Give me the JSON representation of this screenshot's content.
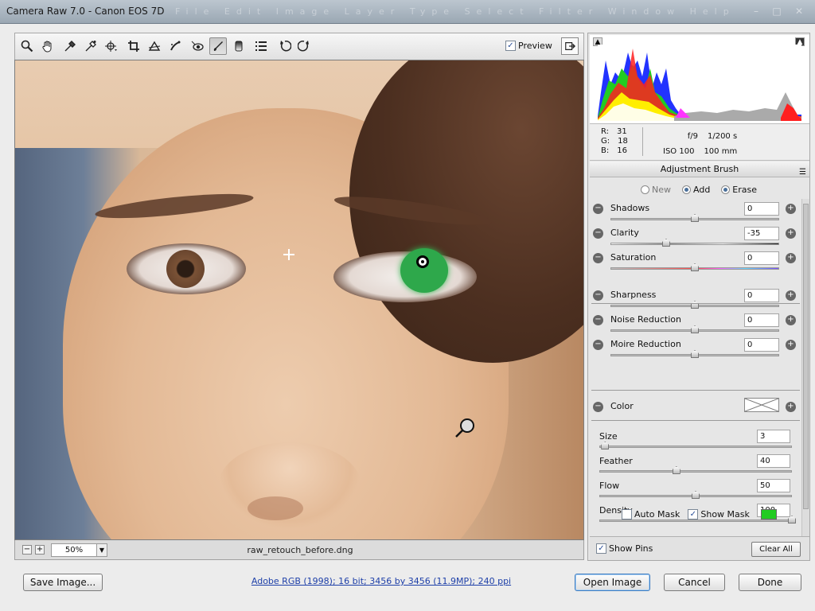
{
  "window": {
    "title": "Camera Raw 7.0  -  Canon EOS 7D",
    "faint_menu": "File  Edit  Image  Layer  Type  Select  Filter  Window  Help"
  },
  "toolbar": {
    "tools": [
      "zoom-icon",
      "hand-icon",
      "white-balance-icon",
      "color-sampler-icon",
      "targeted-adjust-icon",
      "crop-icon",
      "straighten-icon",
      "spot-removal-icon",
      "red-eye-icon",
      "adjustment-brush-icon",
      "graduated-filter-icon",
      "preferences-icon",
      "rotate-ccw-icon",
      "rotate-cw-icon"
    ],
    "active_tool": "adjustment-brush-icon",
    "preview_label": "Preview",
    "preview_checked": true
  },
  "canvas": {
    "zoom_minus": "−",
    "zoom_plus": "+",
    "zoom_value": "50%",
    "filename": "raw_retouch_before.dng"
  },
  "histogram": {
    "colors": {
      "red": "#ff2020",
      "green": "#22cc22",
      "blue": "#2233ff",
      "yellow": "#ffee00",
      "magenta": "#ff33ff",
      "cyan": "#22ddee"
    }
  },
  "readout": {
    "r_label": "R:",
    "r_value": "31",
    "g_label": "G:",
    "g_value": "18",
    "b_label": "B:",
    "b_value": "16",
    "aperture": "f/9",
    "shutter": "1/200 s",
    "iso": "ISO 100",
    "focal": "100 mm"
  },
  "panel": {
    "title": "Adjustment Brush",
    "modes": [
      {
        "label": "New",
        "selected": false
      },
      {
        "label": "Add",
        "selected": true
      },
      {
        "label": "Erase",
        "selected": true
      }
    ],
    "sliders": [
      {
        "label": "Shadows",
        "value": "0",
        "pos": 0.5,
        "track": "plain"
      },
      {
        "label": "Clarity",
        "value": "-35",
        "pos": 0.33,
        "track": "clarity"
      },
      {
        "label": "Saturation",
        "value": "0",
        "pos": 0.5,
        "track": "sat"
      },
      {
        "label": "Sharpness",
        "value": "0",
        "pos": 0.5,
        "track": "plain"
      },
      {
        "label": "Noise Reduction",
        "value": "0",
        "pos": 0.5,
        "track": "plain"
      },
      {
        "label": "Moire Reduction",
        "value": "0",
        "pos": 0.5,
        "track": "plain"
      }
    ],
    "color_label": "Color",
    "brush": [
      {
        "label": "Size",
        "value": "3",
        "pos": 0.03
      },
      {
        "label": "Feather",
        "value": "40",
        "pos": 0.4
      },
      {
        "label": "Flow",
        "value": "50",
        "pos": 0.5
      },
      {
        "label": "Density",
        "value": "100",
        "pos": 1.0
      }
    ],
    "auto_mask_label": "Auto Mask",
    "auto_mask_checked": false,
    "show_mask_label": "Show Mask",
    "show_mask_checked": true,
    "mask_color": "#22cc22",
    "show_pins_label": "Show Pins",
    "show_pins_checked": true,
    "clear_all_label": "Clear All"
  },
  "footer": {
    "save_label": "Save Image...",
    "info_link": "Adobe RGB (1998); 16 bit; 3456 by 3456 (11.9MP); 240 ppi",
    "open_label": "Open Image",
    "cancel_label": "Cancel",
    "done_label": "Done"
  }
}
